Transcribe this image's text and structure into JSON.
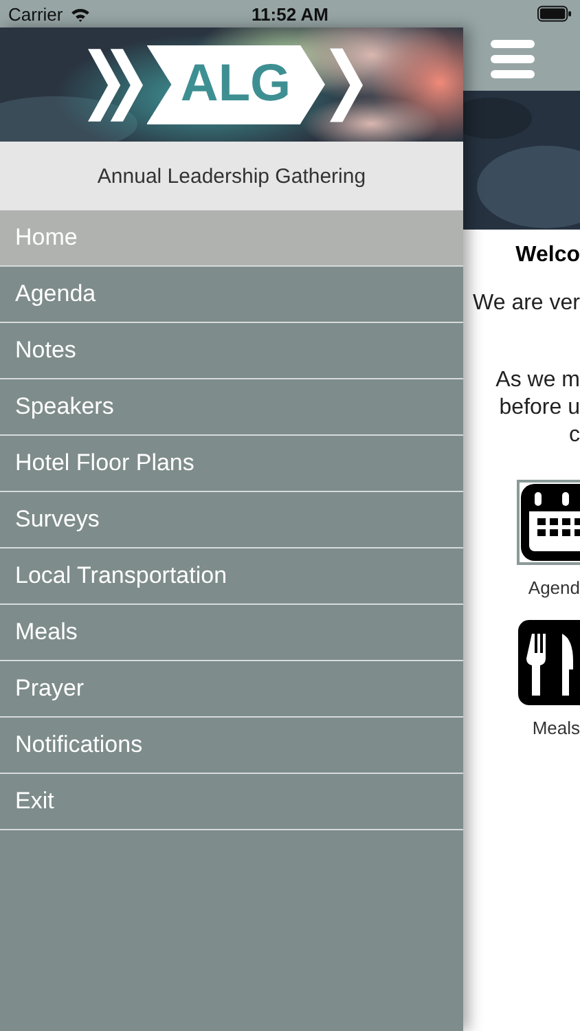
{
  "status_bar": {
    "carrier": "Carrier",
    "time": "11:52 AM"
  },
  "drawer": {
    "logo": "ALG",
    "subtitle": "Annual Leadership Gathering",
    "items": [
      {
        "label": "Home",
        "selected": true
      },
      {
        "label": "Agenda",
        "selected": false
      },
      {
        "label": "Notes",
        "selected": false
      },
      {
        "label": "Speakers",
        "selected": false
      },
      {
        "label": "Hotel Floor Plans",
        "selected": false
      },
      {
        "label": "Surveys",
        "selected": false
      },
      {
        "label": "Local Transportation",
        "selected": false
      },
      {
        "label": "Meals",
        "selected": false
      },
      {
        "label": "Prayer",
        "selected": false
      },
      {
        "label": "Notifications",
        "selected": false
      },
      {
        "label": "Exit",
        "selected": false
      }
    ]
  },
  "main": {
    "title": "Welco",
    "paragraphs": [
      [
        "We are ver"
      ],
      [
        "As we m",
        "before u",
        "c"
      ]
    ],
    "tiles": [
      {
        "label": "Agend",
        "kind": "calendar"
      },
      {
        "label": "Meals",
        "kind": "utensils"
      }
    ]
  }
}
